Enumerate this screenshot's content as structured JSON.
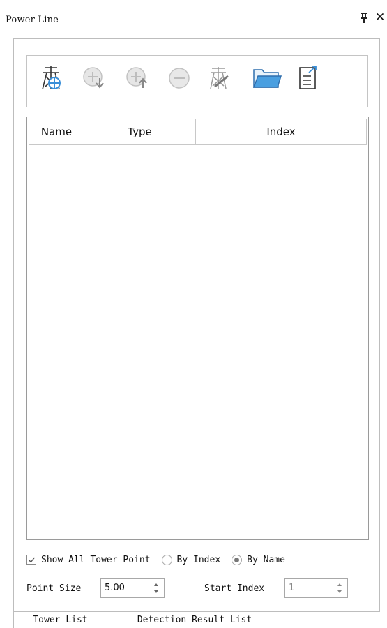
{
  "window": {
    "title": "Power Line"
  },
  "icons": {
    "pin": "pin-icon",
    "close": "close-icon",
    "toolbar": [
      "add-tower-icon",
      "move-down-icon",
      "move-up-icon",
      "remove-icon",
      "edit-tower-icon",
      "open-folder-icon",
      "export-document-icon"
    ]
  },
  "table": {
    "columns": [
      "Name",
      "Type",
      "Index"
    ],
    "rows": []
  },
  "options": {
    "show_all_label": "Show All Tower Point",
    "show_all_checked": true,
    "by_index_label": "By Index",
    "by_name_label": "By Name",
    "selected_sort": "By Name"
  },
  "point_size": {
    "label": "Point Size",
    "value": "5.00"
  },
  "start_index": {
    "label": "Start Index",
    "value": "1"
  },
  "tabs": [
    {
      "label": "Tower List",
      "active": true
    },
    {
      "label": "Detection Result List",
      "active": false
    }
  ],
  "colors": {
    "accent_blue": "#3a8fd8",
    "folder_blue": "#4a9fe0",
    "disabled_gray": "#bdbdbd"
  }
}
